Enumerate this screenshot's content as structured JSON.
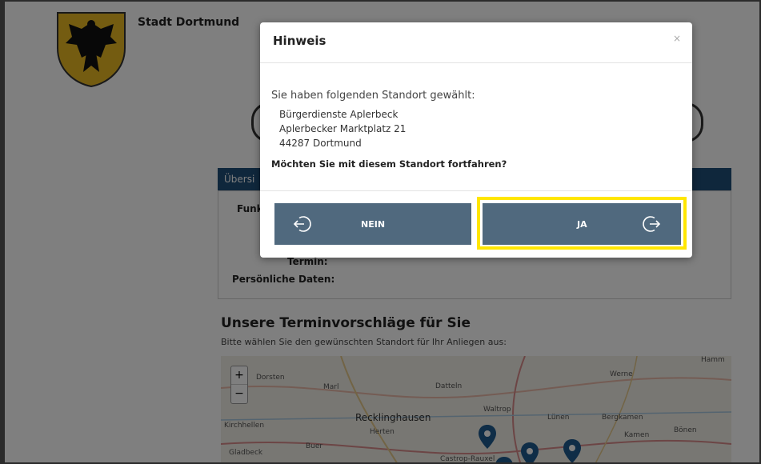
{
  "page": {
    "city_name": "Stadt Dortmund",
    "overview_title": "Übersi",
    "overview_label_1": "Funk",
    "label_termin": "Termin:",
    "label_personal": "Persönliche Daten:",
    "section_title": "Unsere Terminvorschläge für Sie",
    "section_subtitle": "Bitte wählen Sie den gewünschten Standort für Ihr Anliegen aus:"
  },
  "map": {
    "zoom_in": "+",
    "zoom_out": "−",
    "labels": [
      "Dorsten",
      "Marl",
      "Datteln",
      "Waltrop",
      "Werne",
      "Recklinghausen",
      "Herten",
      "Lünen",
      "Bergkamen",
      "Kamen",
      "Bönen",
      "Kirchhellen",
      "Buer",
      "Gladbeck",
      "Castrop-Rauxel",
      "Hamm"
    ]
  },
  "modal": {
    "title": "Hinweis",
    "close": "×",
    "intro": "Sie haben folgenden Standort gewählt:",
    "address_line_1": "Bürgerdienste Aplerbeck",
    "address_line_2": "Aplerbecker Marktplatz 21",
    "address_line_3": "44287 Dortmund",
    "question": "Möchten Sie mit diesem Standort fortfahren?",
    "no_label": "NEIN",
    "yes_label": "JA"
  },
  "colors": {
    "button": "#50697e",
    "highlight": "#ffe600",
    "overview_bar": "#1f4e79"
  }
}
